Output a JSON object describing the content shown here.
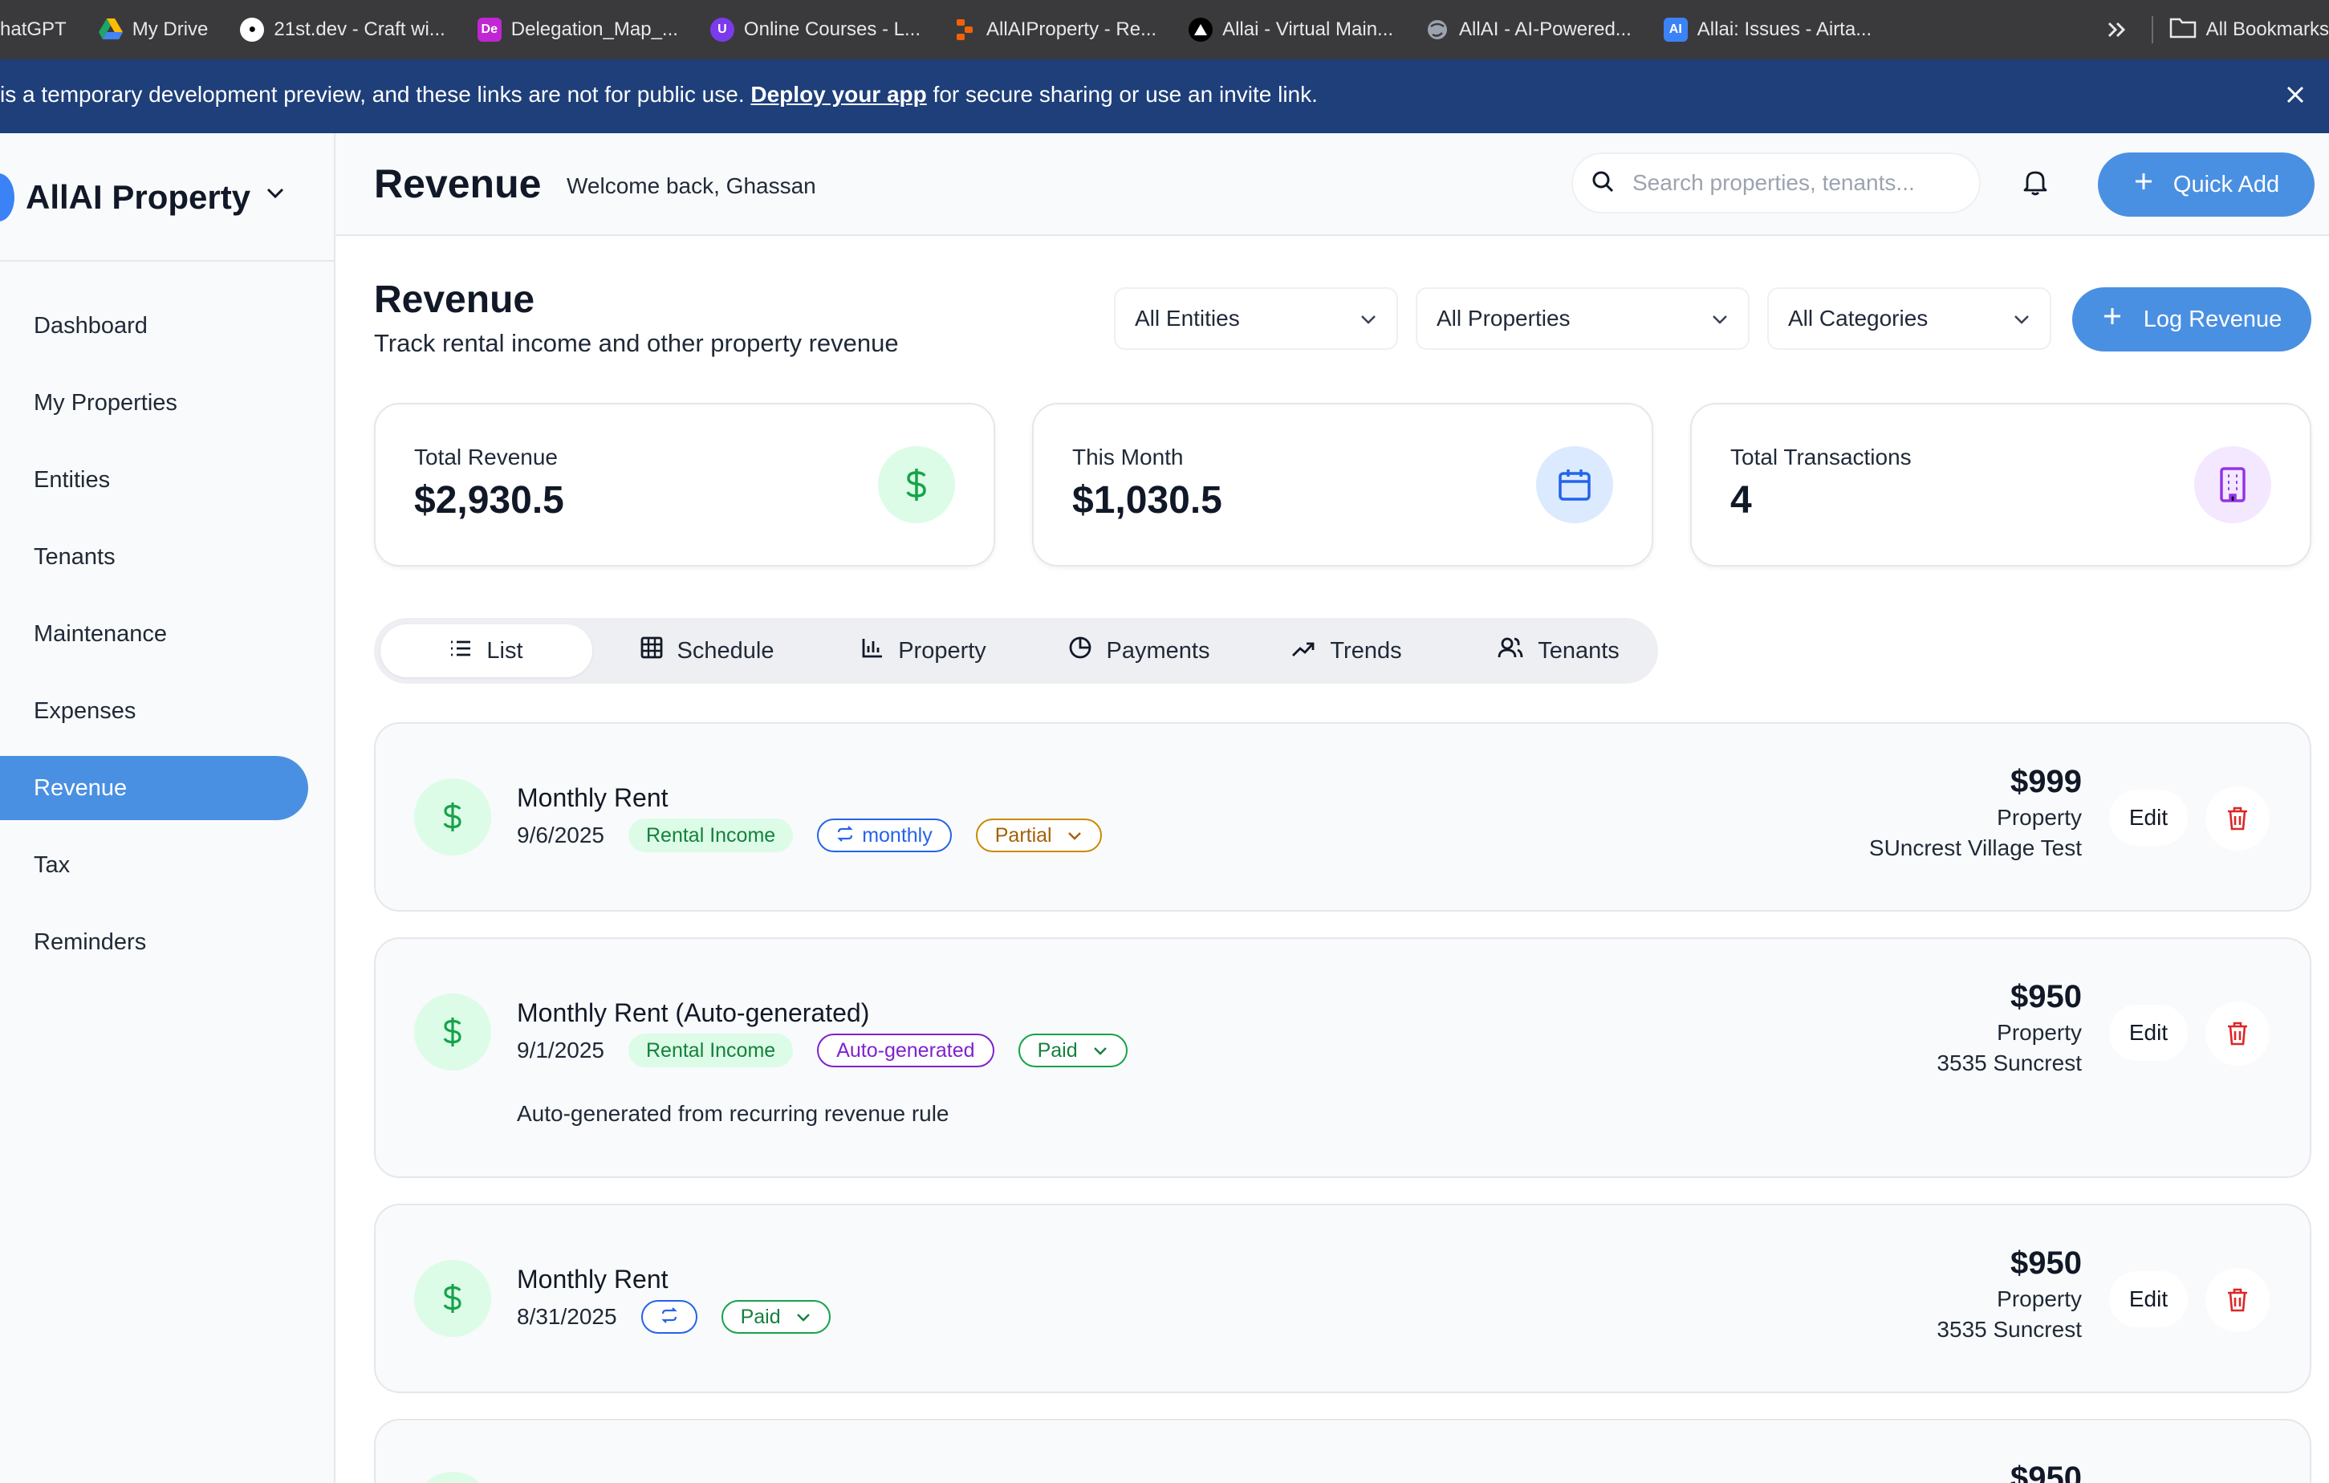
{
  "browser": {
    "bookmarks": [
      {
        "label": "hatGPT",
        "icon": "chatgpt-icon",
        "color": "#10a37f"
      },
      {
        "label": "My Drive",
        "icon": "google-drive-icon",
        "color": "#fbbc04"
      },
      {
        "label": "21st.dev - Craft wi...",
        "icon": "21st-icon",
        "color": "#000000"
      },
      {
        "label": "Delegation_Map_...",
        "icon": "de-icon",
        "color": "#c026d3",
        "glyph": "De"
      },
      {
        "label": "Online Courses - L...",
        "icon": "shield-u-icon",
        "color": "#7c3aed",
        "glyph": "U"
      },
      {
        "label": "AllAIProperty - Re...",
        "icon": "replit-icon",
        "color": "#f26207"
      },
      {
        "label": "Allai - Virtual Main...",
        "icon": "vercel-icon",
        "color": "#000000"
      },
      {
        "label": "AllAI - AI-Powered...",
        "icon": "globe-icon",
        "color": "#9ca3af"
      },
      {
        "label": "Allai: Issues - Airta...",
        "icon": "ai-icon",
        "color": "#3b82f6",
        "glyph": "AI"
      }
    ],
    "all_bookmarks_label": "All Bookmarks"
  },
  "banner": {
    "prefix": "is a temporary development preview, and these links are not for public use.",
    "link": "Deploy your app",
    "suffix": "for secure sharing or use an invite link."
  },
  "sidebar": {
    "brand": "AllAI Property",
    "items": [
      {
        "label": "Dashboard",
        "active": false
      },
      {
        "label": "My Properties",
        "active": false
      },
      {
        "label": "Entities",
        "active": false
      },
      {
        "label": "Tenants",
        "active": false
      },
      {
        "label": "Maintenance",
        "active": false
      },
      {
        "label": "Expenses",
        "active": false
      },
      {
        "label": "Revenue",
        "active": true
      },
      {
        "label": "Tax",
        "active": false
      },
      {
        "label": "Reminders",
        "active": false
      }
    ]
  },
  "header": {
    "title": "Revenue",
    "welcome": "Welcome back, Ghassan",
    "search_placeholder": "Search properties, tenants...",
    "quick_add": "Quick Add"
  },
  "page": {
    "title": "Revenue",
    "subtitle": "Track rental income and other property revenue",
    "filters": {
      "entities": "All Entities",
      "properties": "All Properties",
      "categories": "All Categories"
    },
    "log_button": "Log Revenue"
  },
  "stats": [
    {
      "label": "Total Revenue",
      "value": "$2,930.5",
      "icon": "dollar-icon",
      "bg": "#dcfce7",
      "fg": "#16a34a"
    },
    {
      "label": "This Month",
      "value": "$1,030.5",
      "icon": "calendar-icon",
      "bg": "#dbeafe",
      "fg": "#2563eb"
    },
    {
      "label": "Total Transactions",
      "value": "4",
      "icon": "building-icon",
      "bg": "#f3e8ff",
      "fg": "#9333ea"
    }
  ],
  "tabs": [
    {
      "label": "List",
      "icon": "list-icon",
      "active": true
    },
    {
      "label": "Schedule",
      "icon": "grid-icon",
      "active": false
    },
    {
      "label": "Property",
      "icon": "bar-chart-icon",
      "active": false
    },
    {
      "label": "Payments",
      "icon": "pie-chart-icon",
      "active": false
    },
    {
      "label": "Trends",
      "icon": "trending-up-icon",
      "active": false
    },
    {
      "label": "Tenants",
      "icon": "users-icon",
      "active": false
    }
  ],
  "revenue": [
    {
      "title": "Monthly Rent",
      "date": "9/6/2025",
      "category": "Rental Income",
      "recurrence": "monthly",
      "status": "Partial",
      "amount": "$999",
      "scope": "Property",
      "property": "SUncrest Village Test",
      "edit": "Edit"
    },
    {
      "title": "Monthly Rent (Auto-generated)",
      "date": "9/1/2025",
      "category": "Rental Income",
      "source": "Auto-generated",
      "status": "Paid",
      "note": "Auto-generated from recurring revenue rule",
      "amount": "$950",
      "scope": "Property",
      "property": "3535 Suncrest",
      "edit": "Edit"
    },
    {
      "title": "Monthly Rent",
      "date": "8/31/2025",
      "status": "Paid",
      "amount": "$950",
      "scope": "Property",
      "property": "3535 Suncrest",
      "edit": "Edit"
    },
    {
      "amount": "$950"
    }
  ]
}
